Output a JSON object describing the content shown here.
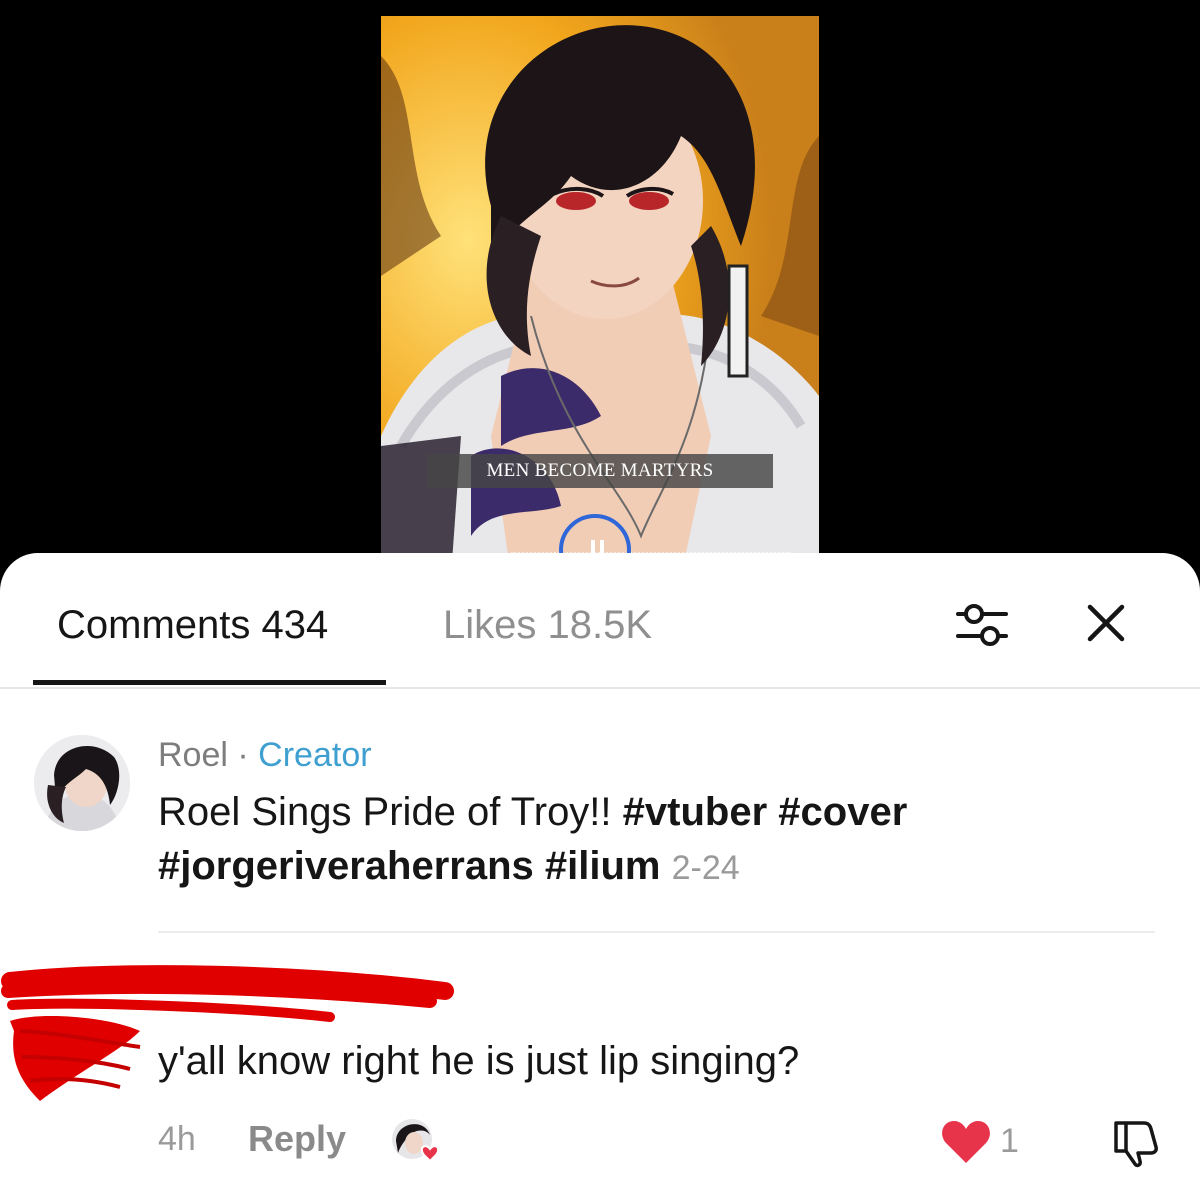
{
  "video": {
    "caption": "MEN BECOME MARTYRS",
    "playback_state": "paused"
  },
  "tabs": {
    "comments_label": "Comments 434",
    "likes_label": "Likes 18.5K",
    "active": "comments"
  },
  "icons": {
    "filter": "sliders-icon",
    "close": "close-icon",
    "like": "heart-icon",
    "dislike": "thumbs-down-icon",
    "pause": "pause-icon"
  },
  "colors": {
    "creator_badge": "#3e9fd0",
    "heart": "#e8344a",
    "redaction": "#e00000",
    "progress_ring": "#2f67d8"
  },
  "comments": [
    {
      "author": "Roel",
      "separator": "·",
      "badge": "Creator",
      "text_plain": "Roel Sings Pride of Troy!!",
      "hashtags_line1": "#vtuber #cover",
      "hashtags_line2": "#jorgeriveraherrans #ilium",
      "date": "2-24"
    },
    {
      "author_redacted": true,
      "text": "y'all know right he is just lip singing?",
      "time": "4h",
      "reply_label": "Reply",
      "likes": "1"
    }
  ]
}
